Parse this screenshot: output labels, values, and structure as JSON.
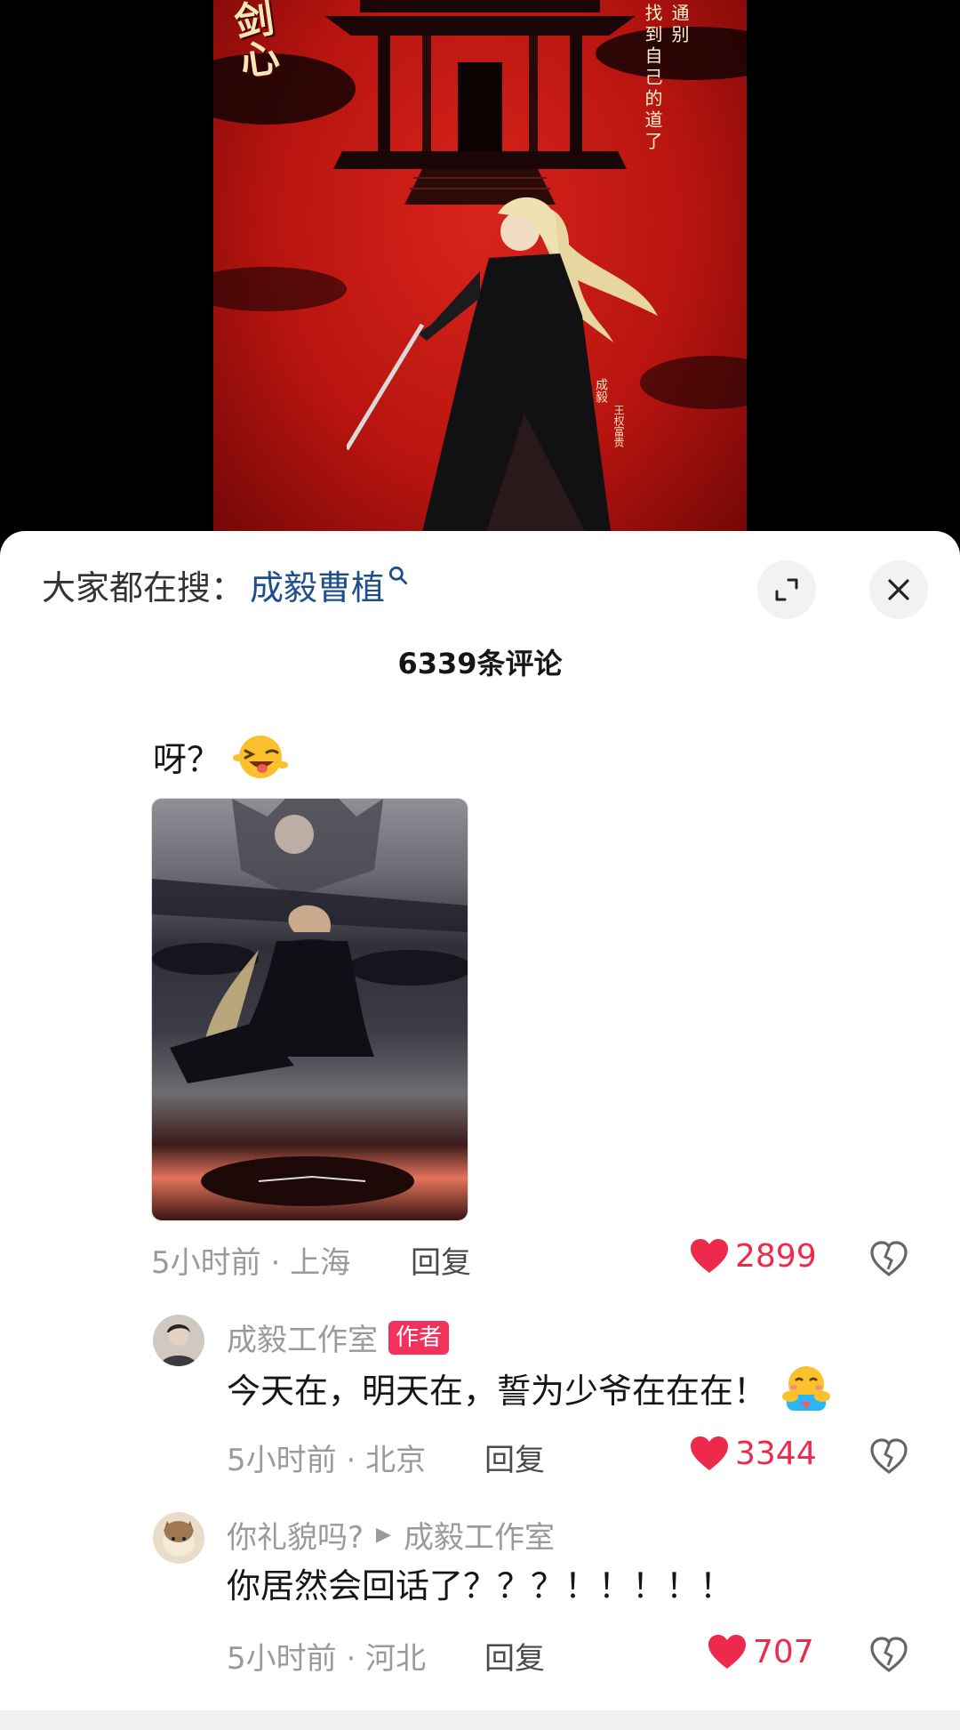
{
  "poster": {
    "title_calligraphy": "剑心",
    "poem_col1": "通别",
    "poem_col2": "找到自己的道了",
    "credit_name": "成毅",
    "credit_team": "王权富贵"
  },
  "header": {
    "search_prefix": "大家都在搜：",
    "search_term": "成毅曹植",
    "comment_count": "6339条评论"
  },
  "comments": [
    {
      "text": "呀？",
      "emoji": "wink-tongue-emoji",
      "time": "5小时前",
      "location": "上海",
      "reply_label": "回复",
      "likes": "2899"
    }
  ],
  "replies": [
    {
      "username": "成毅工作室",
      "badge": "作者",
      "text": "今天在，明天在，誓为少爷在在在！",
      "emoji": "hug-emoji",
      "time": "5小时前",
      "location": "北京",
      "reply_label": "回复",
      "likes": "3344"
    },
    {
      "username": "你礼貌吗?",
      "reply_to": "成毅工作室",
      "text": "你居然会回话了？？？！！！！！",
      "time": "5小时前",
      "location": "河北",
      "reply_label": "回复",
      "likes": "707"
    }
  ],
  "icons": {
    "search": "search-icon",
    "expand": "expand-icon",
    "close": "close-icon",
    "like": "heart-icon",
    "dislike": "broken-heart-icon"
  },
  "colors": {
    "accent_red": "#ee2a4c",
    "search_term_blue": "#1e4f8a",
    "badge_red": "#f2325a"
  }
}
